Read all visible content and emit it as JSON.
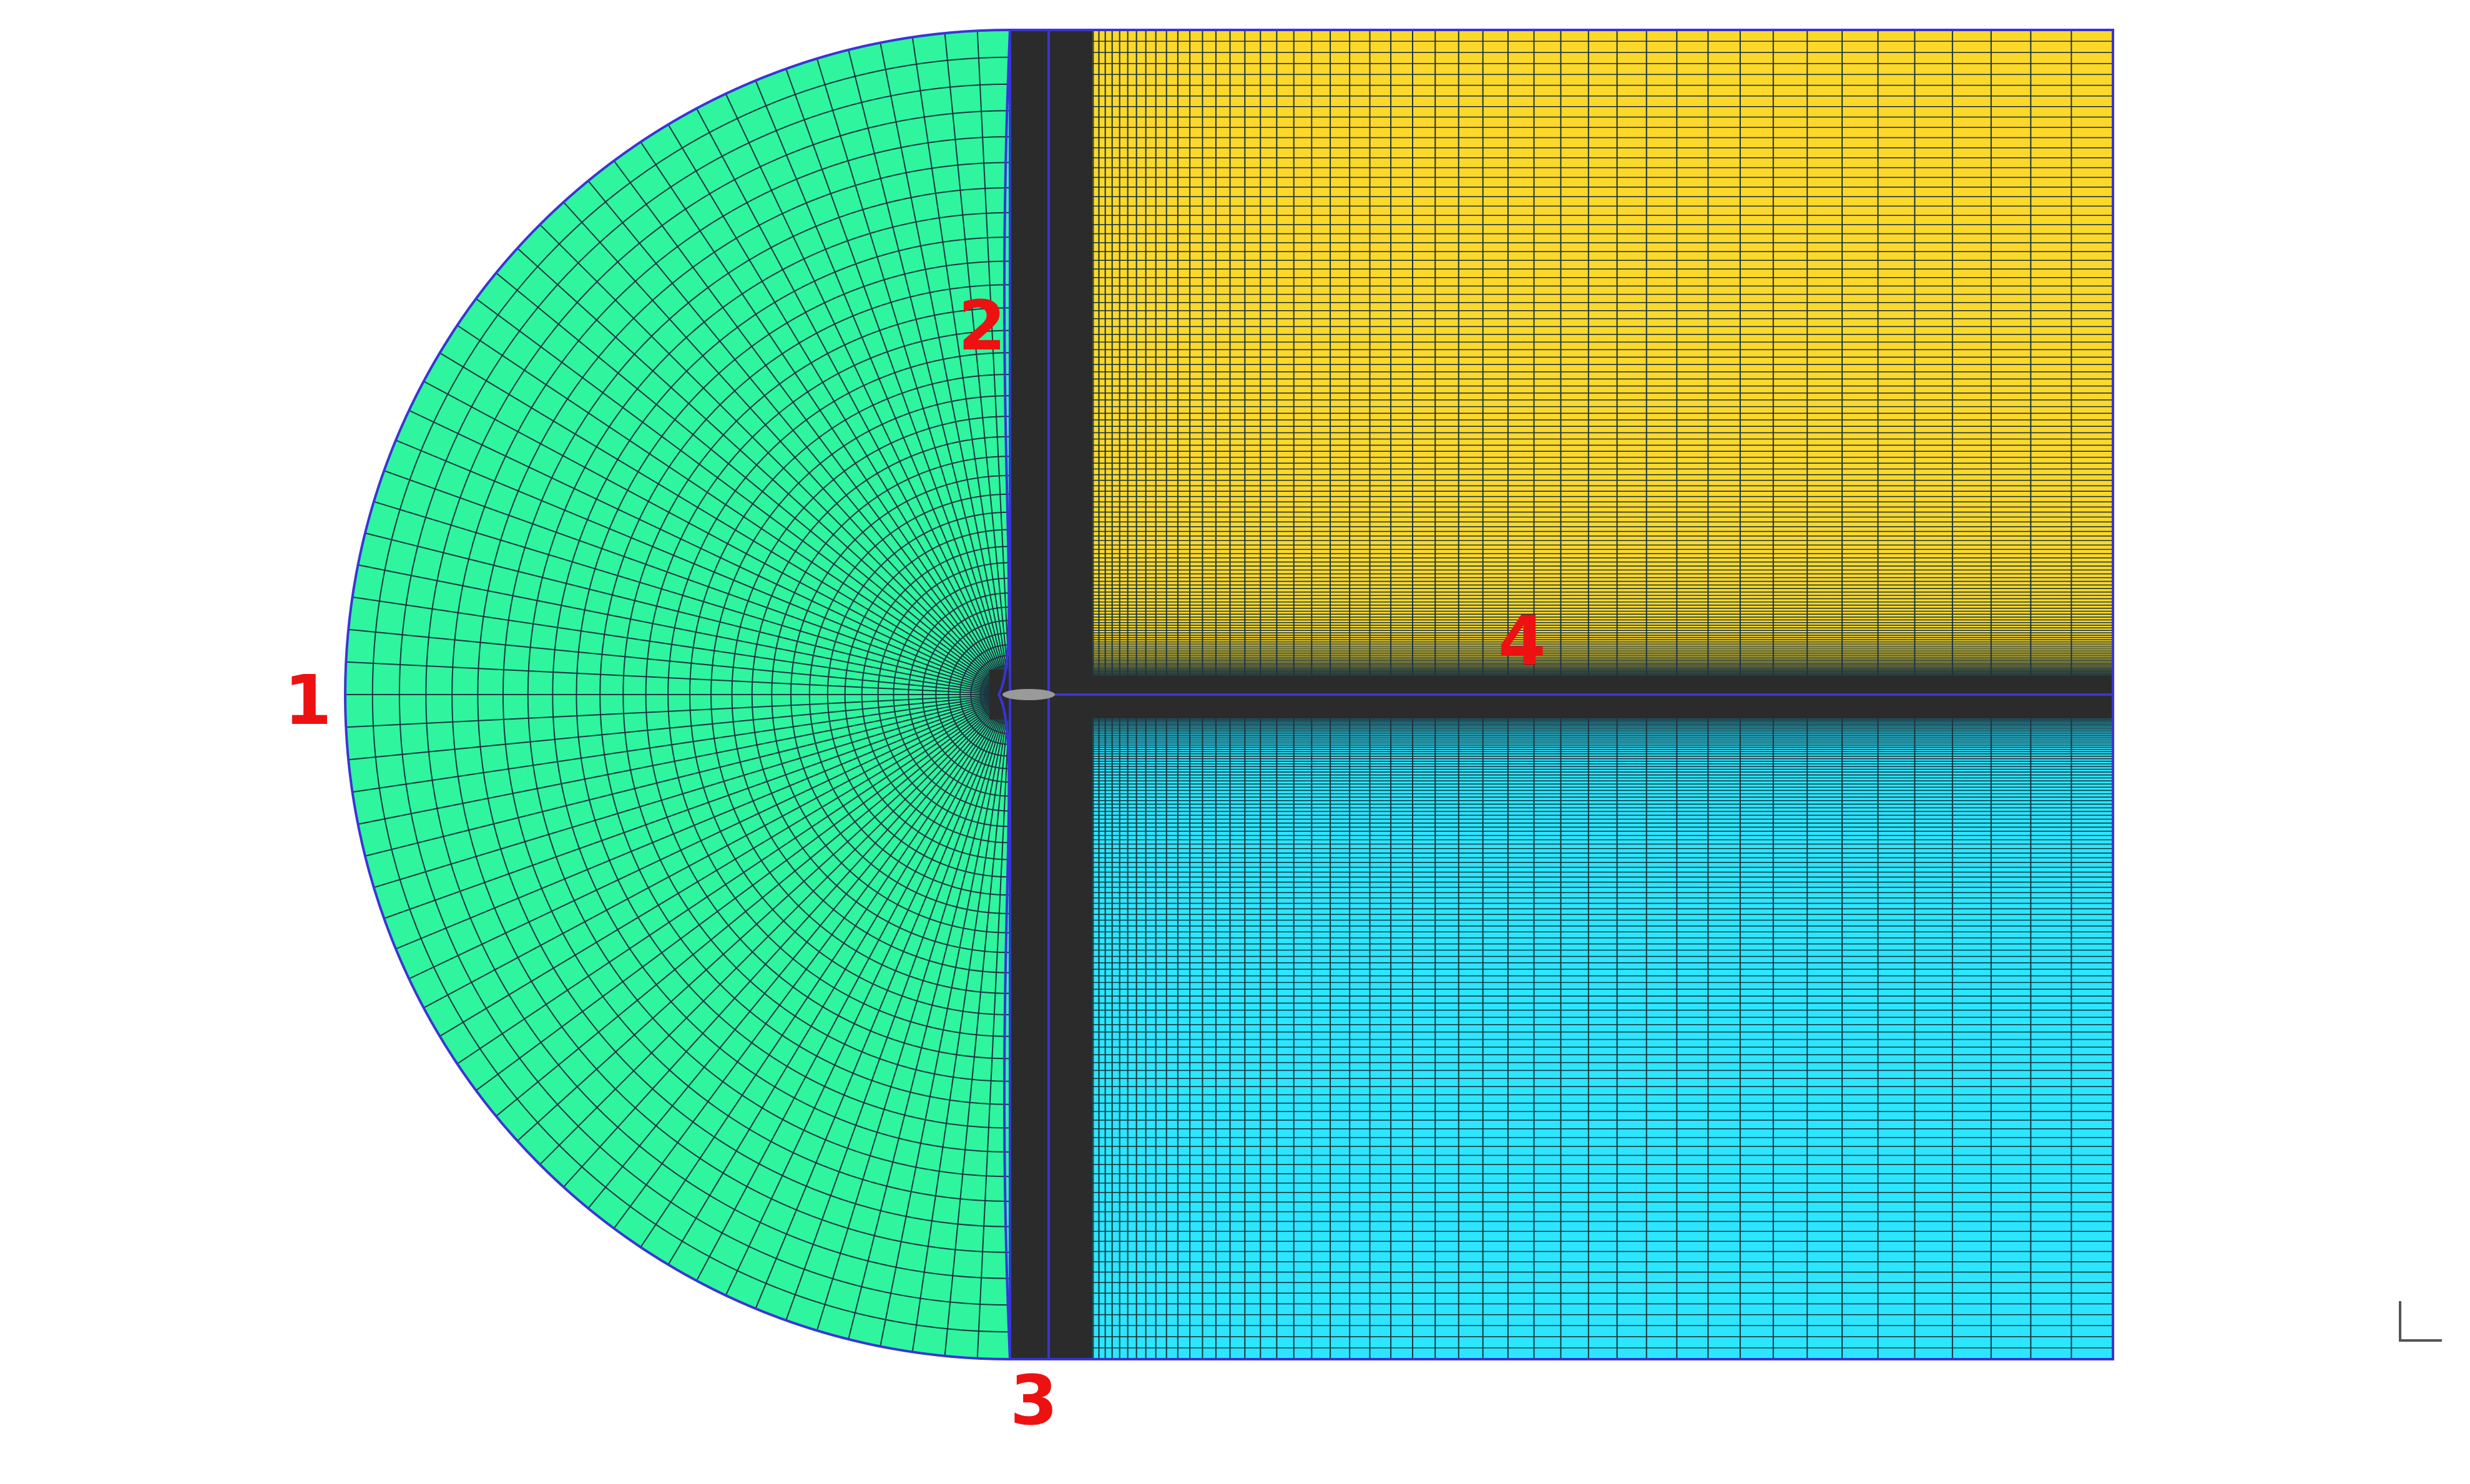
{
  "colors": {
    "background": "#ffffff",
    "c_region": "#2ef59e",
    "top_region": "#fcd82a",
    "bottom_region": "#2be6fe",
    "dense_band": "#2b2b2b",
    "mesh_line": "#1d3540",
    "block_boundary": "#3a34d6",
    "airfoil": "#9a9a9a",
    "label": "#ee1111",
    "corner_mark": "#555555"
  },
  "labels": {
    "far_field_inlet": "1",
    "top_boundary": "2",
    "bottom_boundary": "3",
    "wake_line": "4"
  },
  "mesh": {
    "c_region_radial_lines": 64,
    "c_region_rings": 36,
    "rect_streamwise_lines": 150,
    "rect_vertical_lines": 60
  }
}
